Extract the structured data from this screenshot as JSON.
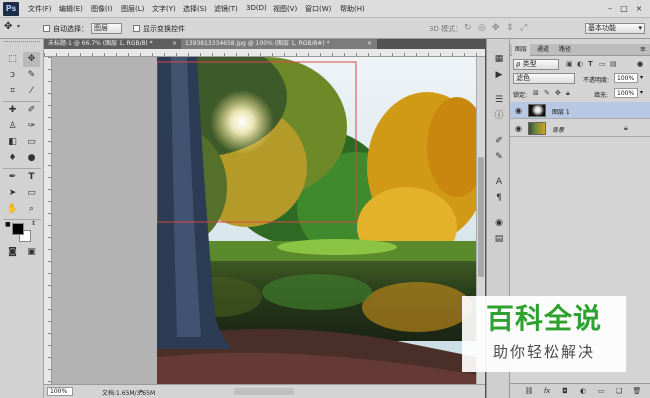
{
  "app": {
    "logo": "Ps"
  },
  "menu": [
    "文件(F)",
    "编辑(E)",
    "图像(I)",
    "图层(L)",
    "文字(Y)",
    "选择(S)",
    "滤镜(T)",
    "3D(D)",
    "视图(V)",
    "窗口(W)",
    "帮助(H)"
  ],
  "options": {
    "auto_select_label": "自动选择：",
    "auto_select_value": "图层",
    "show_transform_label": "显示变换控件",
    "mode_3d": "3D 模式：",
    "workspace": "基本功能"
  },
  "tabs": [
    {
      "label": "未标题-1 @ 66.7% (图层 1, RGB/8) *",
      "active": false
    },
    {
      "label": "1393813334658.jpg @ 100% (图层 1, RGB/8#) *",
      "active": true
    }
  ],
  "status": {
    "zoom": "100%",
    "doc_info": "文档:1.65M/3.65M"
  },
  "panel": {
    "tabs": [
      "图层",
      "通道",
      "路径"
    ],
    "filter_kind": "ρ 类型",
    "blend_mode": "滤色",
    "opacity_label": "不透明度:",
    "opacity_value": "100%",
    "lock_label": "锁定:",
    "fill_label": "填充:",
    "fill_value": "100%",
    "layers": [
      {
        "name": "图层 1",
        "selected": true
      },
      {
        "name": "背景",
        "selected": false,
        "locked": true
      }
    ]
  },
  "watermark": {
    "line1": "百科全说",
    "line2": "助你轻松解决"
  },
  "colors": {
    "accent": "#2fa12f",
    "selection_row": "#b7c8e2",
    "marquee": "#d84545"
  }
}
